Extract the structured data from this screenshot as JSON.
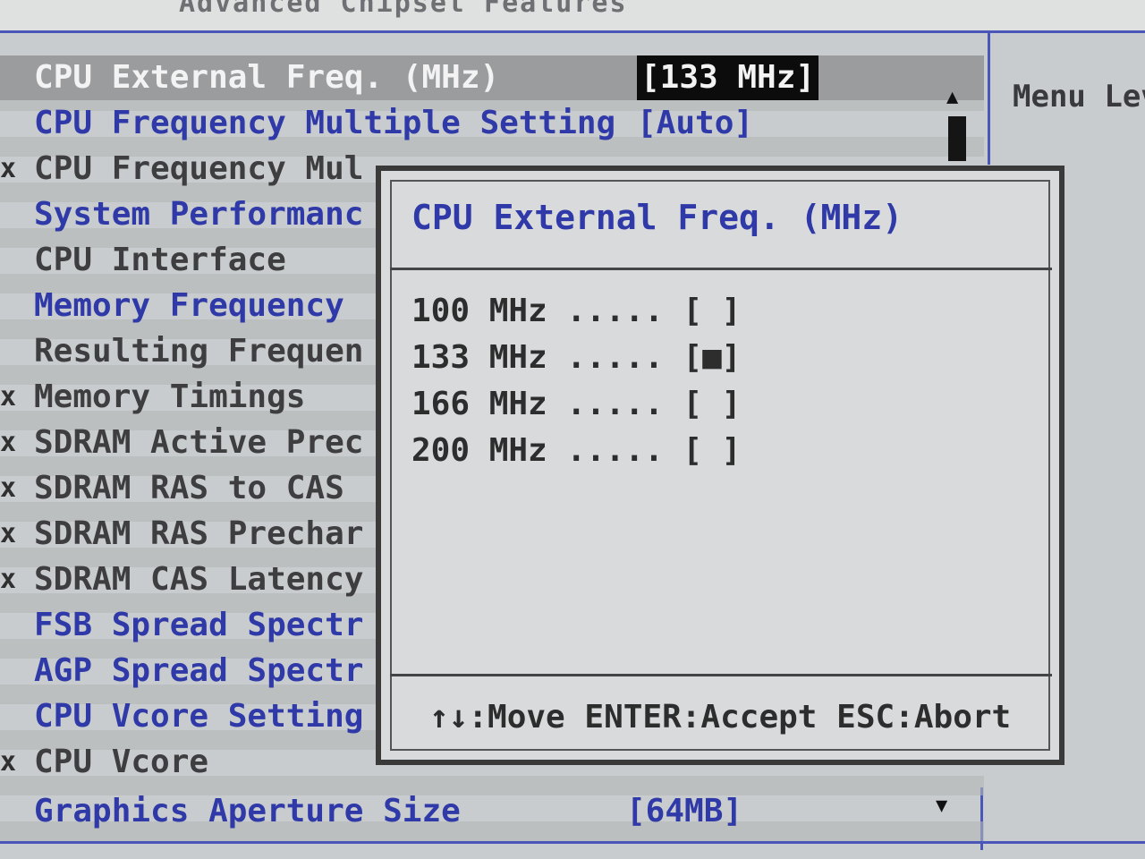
{
  "header": {
    "title": "Advanced Chipset Features"
  },
  "menu_rows": [
    {
      "mark": "",
      "label": "CPU External Freq. (MHz)",
      "value": "[133 MHz]",
      "color": "white",
      "highlighted": true
    },
    {
      "mark": "",
      "label": "CPU Frequency Multiple Setting",
      "value": "[Auto]",
      "color": "blue"
    },
    {
      "mark": "x",
      "label": "CPU Frequency Mul",
      "value": "",
      "color": "gray"
    },
    {
      "mark": "",
      "label": "System Performanc",
      "value": "",
      "color": "blue"
    },
    {
      "mark": "",
      "label": "CPU Interface",
      "value": "",
      "color": "gray"
    },
    {
      "mark": "",
      "label": "Memory Frequency",
      "value": "",
      "color": "blue"
    },
    {
      "mark": "",
      "label": "Resulting Frequen",
      "value": "",
      "color": "gray"
    },
    {
      "mark": "x",
      "label": "Memory Timings",
      "value": "",
      "color": "gray"
    },
    {
      "mark": "x",
      "label": "SDRAM Active Prec",
      "value": "",
      "color": "gray"
    },
    {
      "mark": "x",
      "label": "SDRAM RAS to CAS",
      "value": "",
      "color": "gray"
    },
    {
      "mark": "x",
      "label": "SDRAM RAS Prechar",
      "value": "",
      "color": "gray"
    },
    {
      "mark": "x",
      "label": "SDRAM CAS Latency",
      "value": "",
      "color": "gray"
    },
    {
      "mark": "",
      "label": "FSB Spread Spectr",
      "value": "",
      "color": "blue"
    },
    {
      "mark": "",
      "label": "AGP Spread Spectr",
      "value": "",
      "color": "blue"
    },
    {
      "mark": "",
      "label": "CPU Vcore Setting",
      "value": "",
      "color": "blue"
    },
    {
      "mark": "x",
      "label": "CPU Vcore",
      "value": "",
      "color": "gray"
    },
    {
      "mark": "",
      "label": "Graphics Aperture Size",
      "value": "[64MB]",
      "color": "blue"
    }
  ],
  "side_help": {
    "label": "Menu Lev"
  },
  "scroll": {
    "up_glyph": "▲",
    "down_glyph": "▼"
  },
  "popup": {
    "title": "CPU External Freq. (MHz)",
    "options": [
      {
        "label": "100 MHz ..... [ ]"
      },
      {
        "label": "133 MHz ..... [■]"
      },
      {
        "label": "166 MHz ..... [ ]"
      },
      {
        "label": "200 MHz ..... [ ]"
      }
    ],
    "selected_value": "133 MHz",
    "footer": "↑↓:Move ENTER:Accept ESC:Abort"
  },
  "colors": {
    "blue": "#2f3aa8",
    "gray": "#3e3e40",
    "white": "#f3f3f3",
    "background": "#c9ccce"
  }
}
